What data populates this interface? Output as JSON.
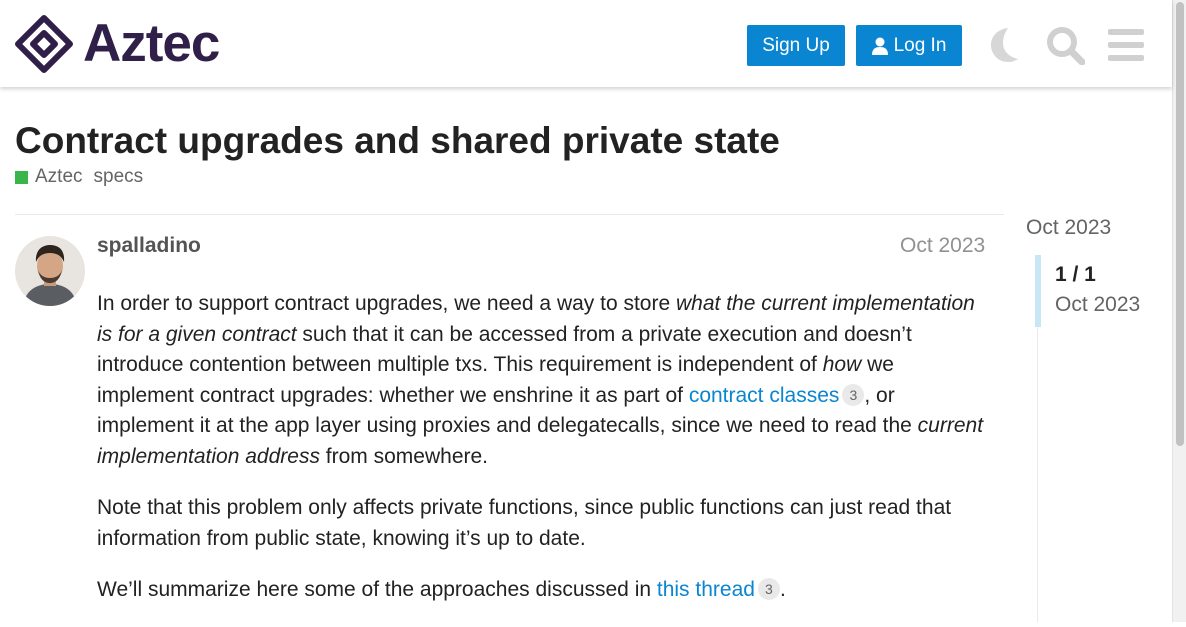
{
  "header": {
    "logo_text": "Aztec",
    "signup_label": "Sign Up",
    "login_label": "Log In",
    "icons": [
      "moon-icon",
      "search-icon",
      "menu-icon"
    ]
  },
  "topic": {
    "title": "Contract upgrades and shared private state",
    "category": "Aztec",
    "category_color": "#3ab54a",
    "tag": "specs"
  },
  "post": {
    "username": "spalladino",
    "date": "Oct 2023",
    "p1": {
      "t1": "In order to support contract upgrades, we need a way to store ",
      "em1": "what the current implementation is for a given contract",
      "t2": " such that it can be accessed from a private execution and doesn’t introduce contention between multiple txs. This requirement is independent of ",
      "em2": "how",
      "t3": " we implement contract upgrades: whether we enshrine it as part of ",
      "link1": "contract classes",
      "link1_count": "3",
      "t4": ", or implement it at the app layer using proxies and delegatecalls, since we need to read the ",
      "em3": "current implementation address",
      "t5": " from somewhere."
    },
    "p2": "Note that this problem only affects private functions, since public functions can just read that information from public state, knowing it’s up to date.",
    "p3": {
      "t1": "We’ll summarize here some of the approaches discussed in ",
      "link": "this thread",
      "link_count": "3",
      "t2": "."
    }
  },
  "timeline": {
    "top_date": "Oct 2023",
    "count": "1 / 1",
    "date": "Oct 2023"
  },
  "colors": {
    "accent": "#0a85d1",
    "brand": "#2f1f49"
  }
}
